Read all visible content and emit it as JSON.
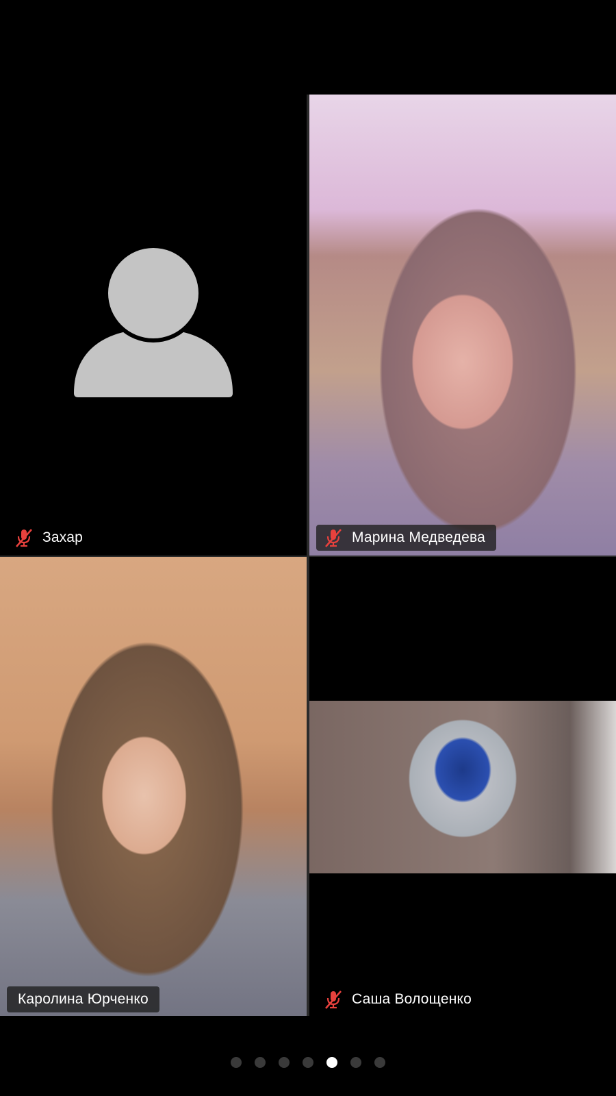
{
  "participants": [
    {
      "name": "Захар",
      "muted": true,
      "video": false
    },
    {
      "name": "Марина Медведева",
      "muted": true,
      "video": true
    },
    {
      "name": "Каролина Юрченко",
      "muted": false,
      "video": true
    },
    {
      "name": "Саша Волощенко",
      "muted": true,
      "video": true
    }
  ],
  "pagination": {
    "total_pages": 7,
    "current_page": 5
  },
  "colors": {
    "muted_icon": "#e8413d",
    "avatar_fill": "#c4c4c4",
    "background": "#000000"
  },
  "icons": {
    "muted": "mic-muted-icon",
    "avatar": "avatar-placeholder-icon"
  }
}
